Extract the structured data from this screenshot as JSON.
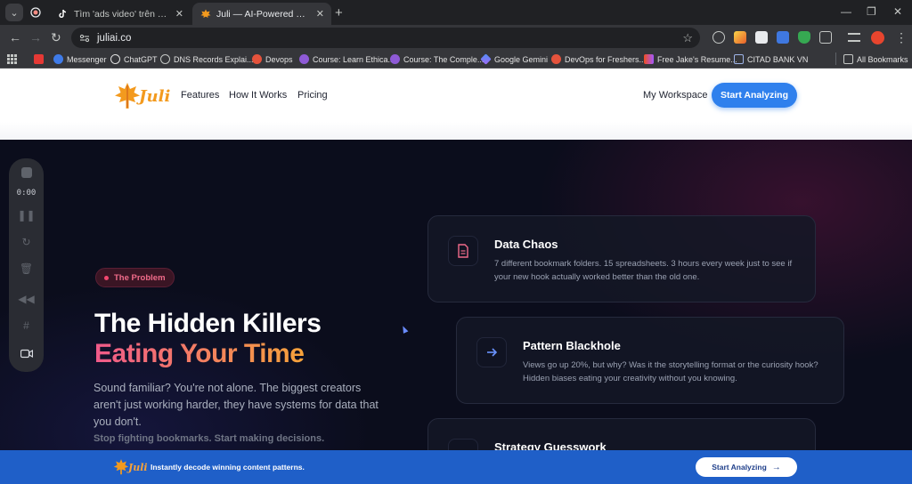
{
  "browser": {
    "tabs": [
      {
        "title": "Tìm 'ads video' trên TikTok | Tìm",
        "active": false
      },
      {
        "title": "Juli — AI-Powered Content Wo",
        "active": true
      }
    ],
    "url": "juliai.co",
    "bookmarks": [
      "Messenger",
      "ChatGPT",
      "DNS Records Explai...",
      "Devops",
      "Course: Learn Ethica...",
      "Course: The Comple...",
      "Google Gemini",
      "DevOps for Freshers...",
      "Free Jake's Resume...",
      "CITAD BANK VN"
    ],
    "all_bookmarks": "All Bookmarks"
  },
  "site": {
    "logo_text": "Juli",
    "nav": [
      "Features",
      "How It Works",
      "Pricing"
    ],
    "workspace": "My Workspace",
    "cta": "Start Analyzing"
  },
  "recorder": {
    "time": "0:00"
  },
  "hero": {
    "badge": "The Problem",
    "title_line1": "The Hidden Killers",
    "title_line2": "Eating Your Time",
    "lead": "Sound familiar? You're not alone. The biggest creators aren't just working harder, they have systems for data that you don't.",
    "tagline": "Stop fighting bookmarks. Start making decisions."
  },
  "cards": [
    {
      "title": "Data Chaos",
      "desc": "7 different bookmark folders. 15 spreadsheets. 3 hours every week just to see if your new hook actually worked better than the old one.",
      "icon": "document-icon"
    },
    {
      "title": "Pattern Blackhole",
      "desc": "Views go up 20%, but why? Was it the storytelling format or the curiosity hook? Hidden biases eating your creativity without you knowing.",
      "icon": "arrow-right-icon"
    },
    {
      "title": "Strategy Guesswork",
      "desc": "",
      "icon": "chart-icon"
    }
  ],
  "footer": {
    "logo_text": "Juli",
    "text": "Instantly decode winning content patterns.",
    "cta": "Start Analyzing"
  },
  "colors": {
    "accent": "#2f80ed",
    "brand_orange": "#f39a1e",
    "pink": "#f05a8a",
    "banner": "#1f5fc8"
  }
}
